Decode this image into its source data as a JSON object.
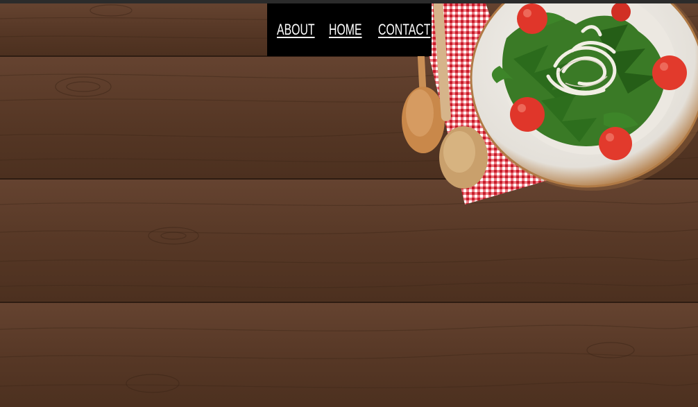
{
  "nav": {
    "items": [
      {
        "label": "ABOUT"
      },
      {
        "label": "HOME"
      },
      {
        "label": "CONTACT"
      }
    ]
  },
  "colors": {
    "wood": "#5a3a27",
    "nav_bg": "#000000",
    "nav_text": "#ffffff",
    "napkin_red": "#d8232f",
    "greens": "#2f6a1f",
    "tomato": "#e23a2c"
  },
  "hero": {
    "image": "wood-table-with-salad-bowl-and-wooden-spoons"
  }
}
